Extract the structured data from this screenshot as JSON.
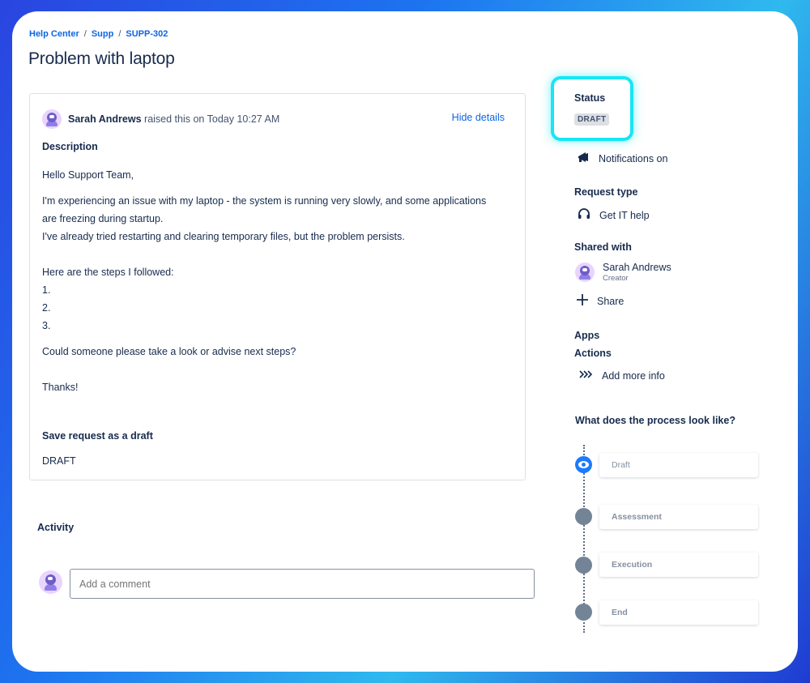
{
  "breadcrumb": {
    "items": [
      "Help Center",
      "Supp",
      "SUPP-302"
    ],
    "separator": "/"
  },
  "title": "Problem with laptop",
  "request": {
    "raiser_name": "Sarah Andrews",
    "raised_text": "raised this on Today 10:27 AM",
    "hide_details": "Hide details",
    "description_label": "Description",
    "description_lines": [
      "Hello Support Team,",
      "I'm experiencing an issue with my laptop - the system is running very slowly, and some applications",
      "are freezing during startup.",
      "I've already tried restarting and clearing temporary files, but the problem persists.",
      "Here are the steps I followed:",
      "1.",
      "2.",
      "3.",
      "Could someone please take a look or advise next steps?",
      "Thanks!"
    ],
    "save_label": "Save request as a draft",
    "save_value": "DRAFT"
  },
  "activity": {
    "label": "Activity",
    "comment_placeholder": "Add a comment"
  },
  "sidebar": {
    "status_label": "Status",
    "status_value": "DRAFT",
    "notifications": "Notifications on",
    "request_type_label": "Request type",
    "request_type": "Get IT help",
    "shared_label": "Shared with",
    "shared_name": "Sarah Andrews",
    "shared_role": "Creator",
    "share": "Share",
    "apps_label": "Apps",
    "actions_label": "Actions",
    "add_more_info": "Add more info",
    "process_label": "What does the process look like?",
    "steps": [
      "Draft",
      "Assessment",
      "Execution",
      "End"
    ]
  },
  "colors": {
    "accent": "#0c66e4",
    "status_highlight": "#16e6f5",
    "active_step": "#1d7afc"
  },
  "icons": {
    "notifications": "megaphone-icon",
    "request_type": "headset-icon",
    "share": "plus-icon",
    "add_more_info": "triple-chevron-icon"
  }
}
